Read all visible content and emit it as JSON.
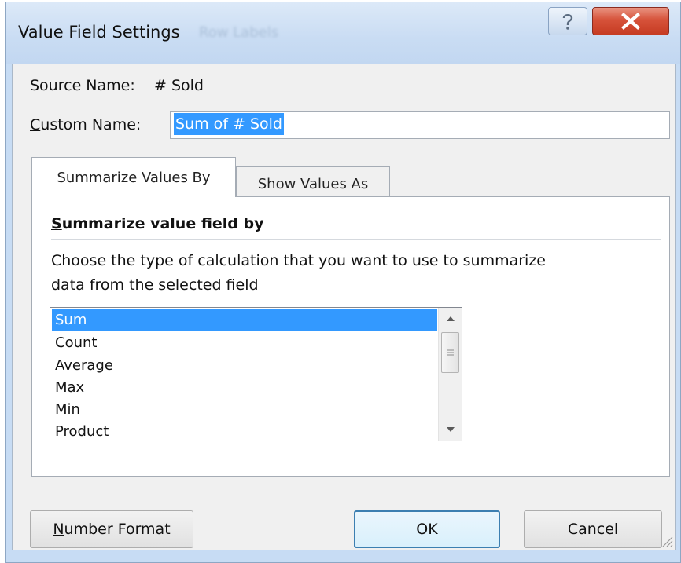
{
  "window": {
    "title": "Value Field Settings",
    "background_text": "Row Labels",
    "help_icon": "question-mark-icon",
    "close_icon": "close-x-icon"
  },
  "source": {
    "label": "Source Name:",
    "value": "# Sold"
  },
  "custom_name": {
    "label_prefix": "C",
    "label_rest": "ustom Name:",
    "value": "Sum of # Sold"
  },
  "tabs": [
    {
      "label": "Summarize Values By",
      "active": true
    },
    {
      "label": "Show Values As",
      "active": false
    }
  ],
  "panel": {
    "section_title_prefix": "S",
    "section_title_rest": "ummarize value field by",
    "description_line1": "Choose the type of calculation that you want to use to summarize",
    "description_line2": "data from the selected field"
  },
  "calculation_list": {
    "items": [
      "Sum",
      "Count",
      "Average",
      "Max",
      "Min",
      "Product"
    ],
    "selected": "Sum"
  },
  "buttons": {
    "number_format_prefix": "N",
    "number_format_rest": "umber Format",
    "ok": "OK",
    "cancel": "Cancel"
  },
  "colors": {
    "selection": "#3399ff",
    "close_button": "#c63b22",
    "title_bar": "#c9dcf3",
    "default_button_border": "#3c7fb1"
  }
}
